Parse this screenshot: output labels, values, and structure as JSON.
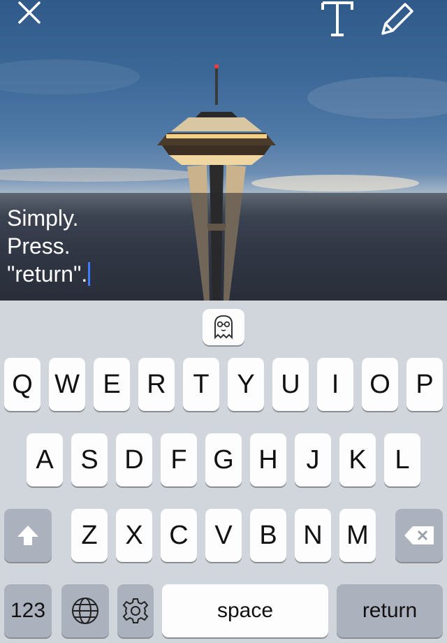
{
  "caption": {
    "lines": [
      "Simply.",
      "Press.",
      "\"return\"."
    ]
  },
  "toolbar": {
    "close_icon": "close-icon",
    "text_icon": "text-tool-icon",
    "pencil_icon": "pencil-icon"
  },
  "keyboard": {
    "row1": [
      "Q",
      "W",
      "E",
      "R",
      "T",
      "Y",
      "U",
      "I",
      "O",
      "P"
    ],
    "row2": [
      "A",
      "S",
      "D",
      "F",
      "G",
      "H",
      "J",
      "K",
      "L"
    ],
    "row3": [
      "Z",
      "X",
      "C",
      "V",
      "B",
      "N",
      "M"
    ],
    "numbers_label": "123",
    "space_label": "space",
    "return_label": "return",
    "emoji_suggestion_icon": "ghost-icon"
  }
}
